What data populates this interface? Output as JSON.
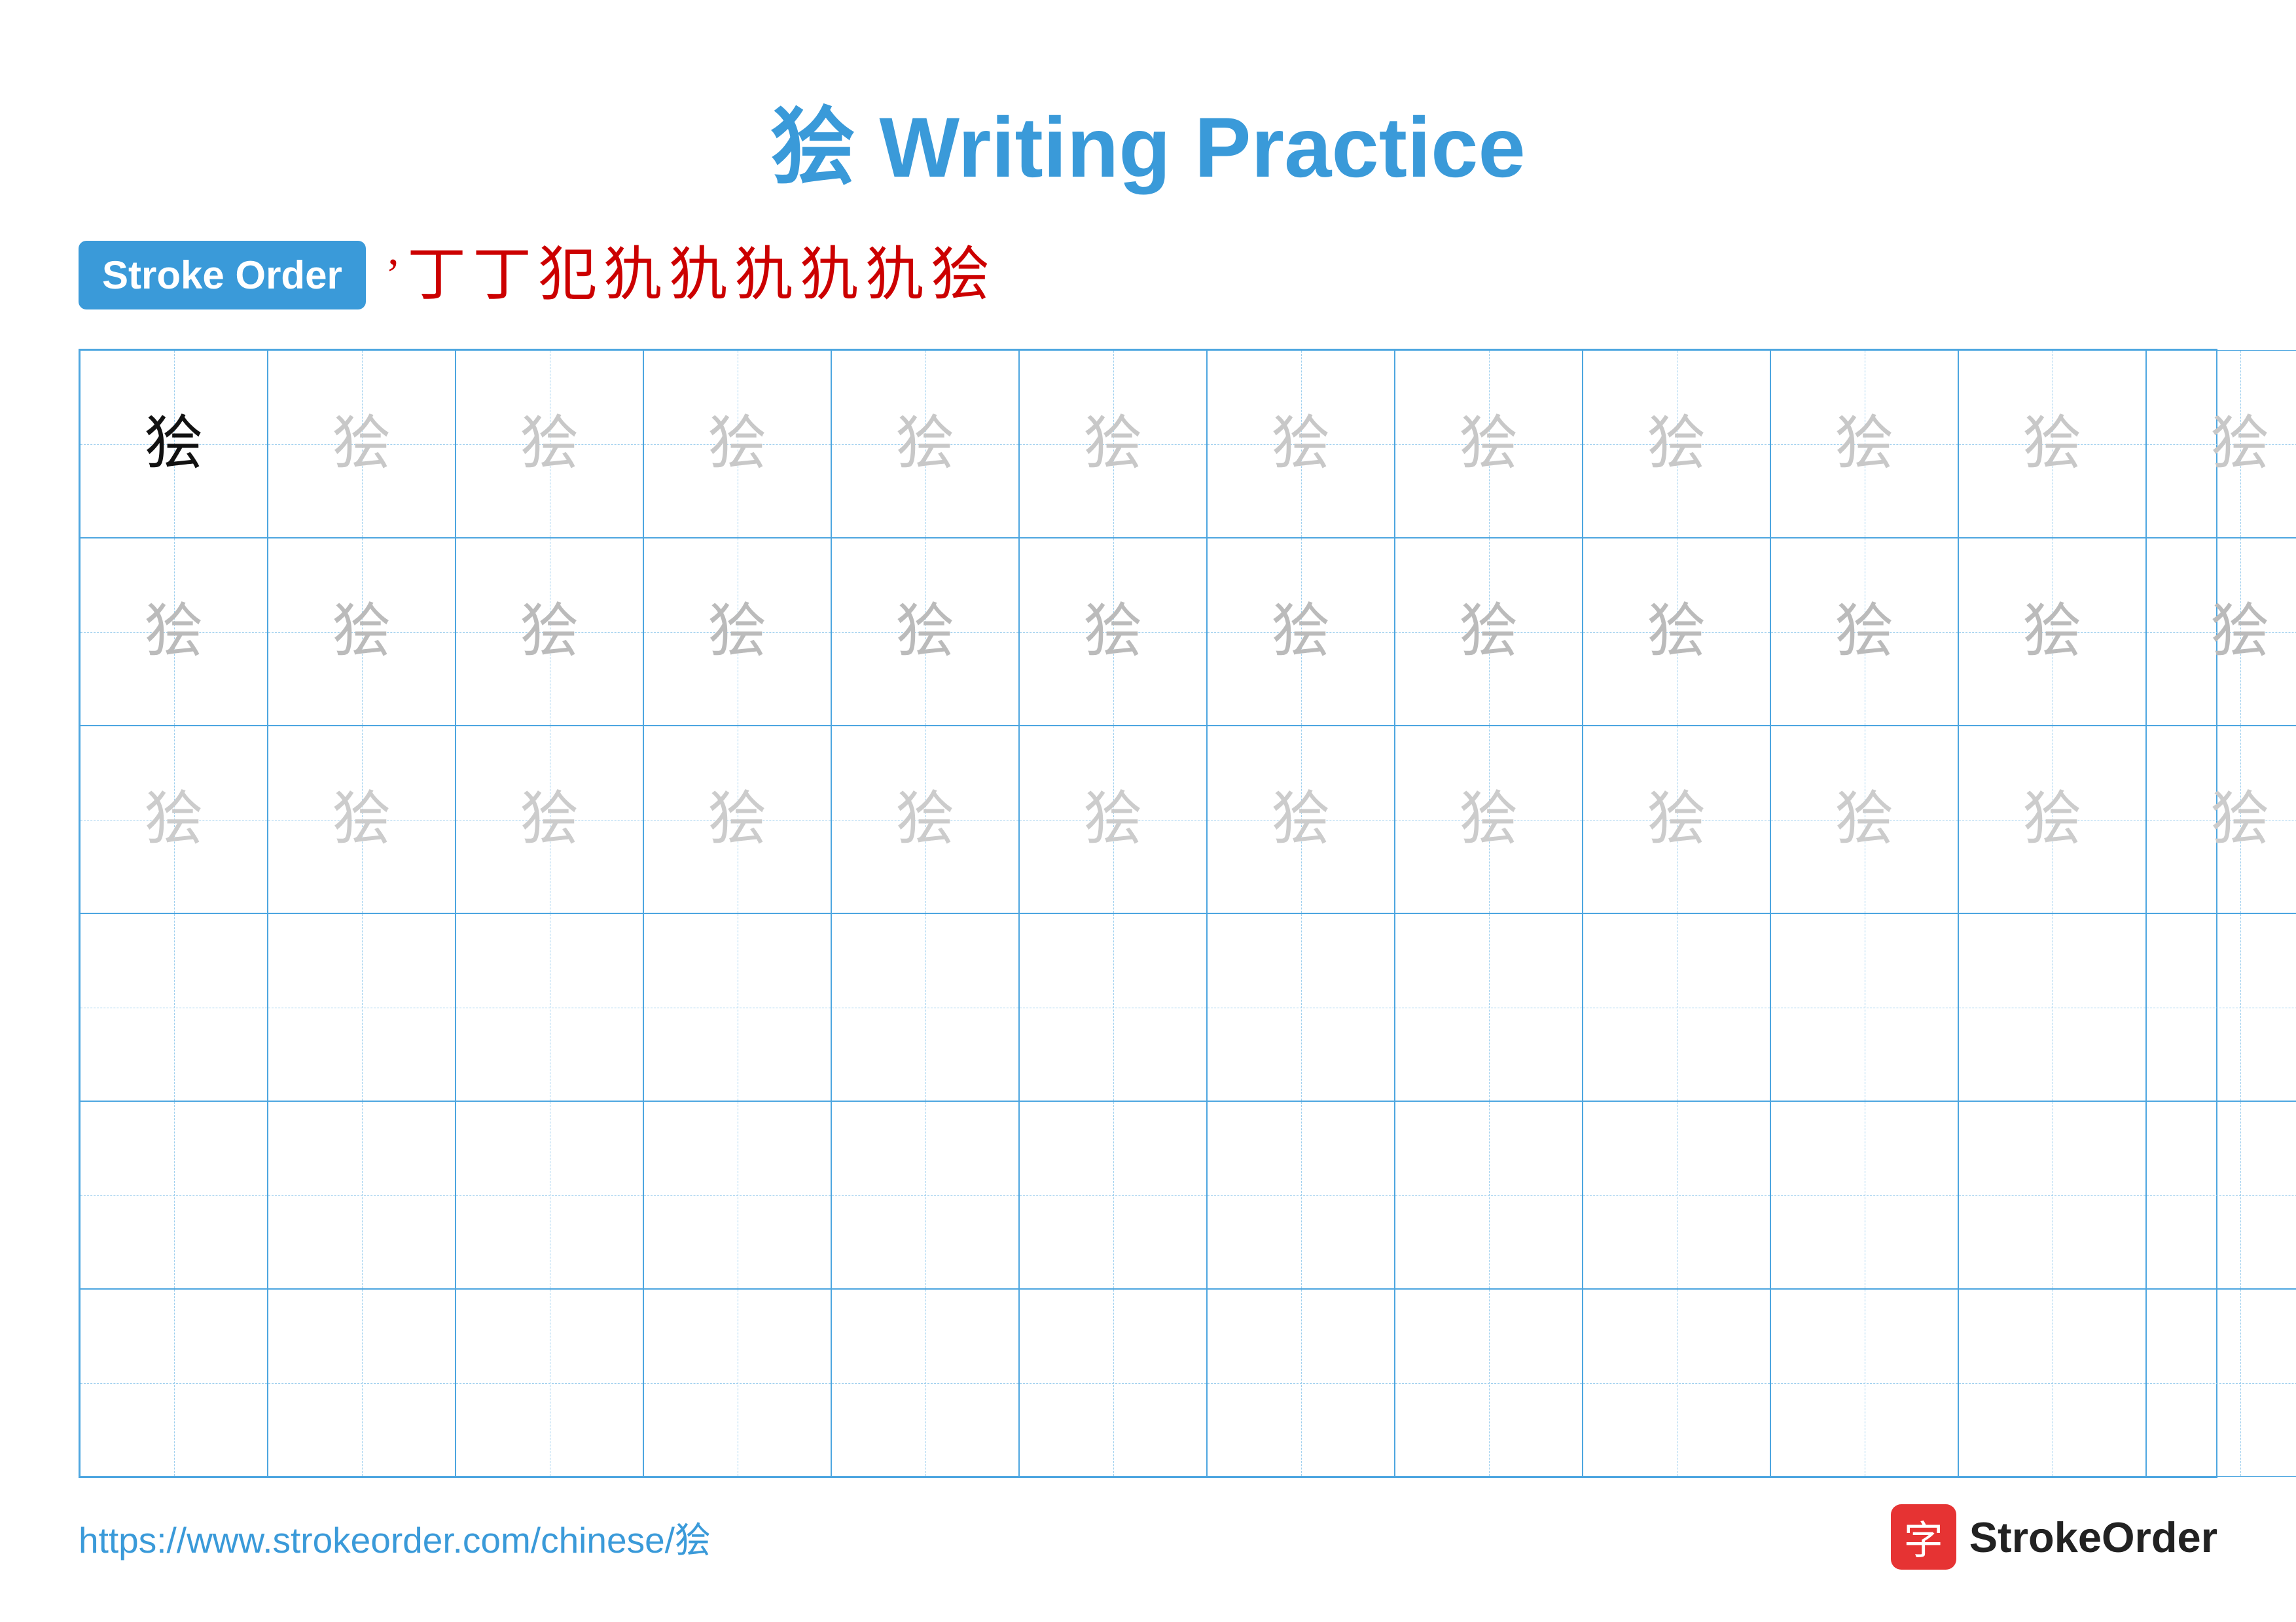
{
  "title": "狯 Writing Practice",
  "stroke_order": {
    "label": "Stroke Order",
    "strokes": [
      "丶",
      "𠄌",
      "𠄌",
      "㇒",
      "㇗",
      "㇗",
      "㇗",
      "㇗",
      "㇗",
      "狯"
    ]
  },
  "character": "狯",
  "grid": {
    "cols": 13,
    "rows": 6
  },
  "footer": {
    "url": "https://www.strokeorder.com/chinese/狯",
    "logo_text": "StrokeOrder",
    "logo_char": "字"
  }
}
